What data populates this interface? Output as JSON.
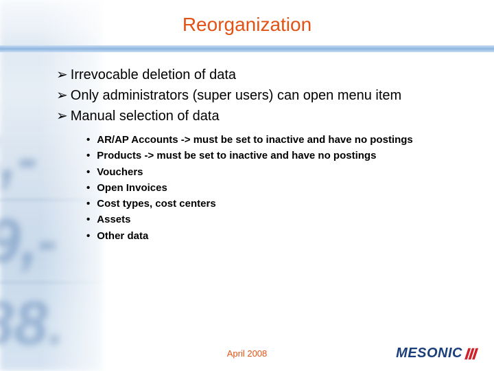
{
  "title": "Reorganization",
  "main_points": [
    "Irrevocable deletion of data",
    "Only administrators (super users) can open menu item",
    "Manual selection of data"
  ],
  "sub_points": [
    "AR/AP Accounts -> must be set to inactive and have no postings",
    "Products -> must be set to inactive and have no postings",
    "Vouchers",
    "Open Invoices",
    "Cost types, cost centers",
    "Assets",
    "Other data"
  ],
  "footer_date": "April 2008",
  "logo_text": "MESONIC",
  "colors": {
    "title": "#e25215",
    "accent_blue": "#8fb6e0",
    "logo_blue": "#1a3e7a",
    "logo_red": "#d0202a"
  }
}
